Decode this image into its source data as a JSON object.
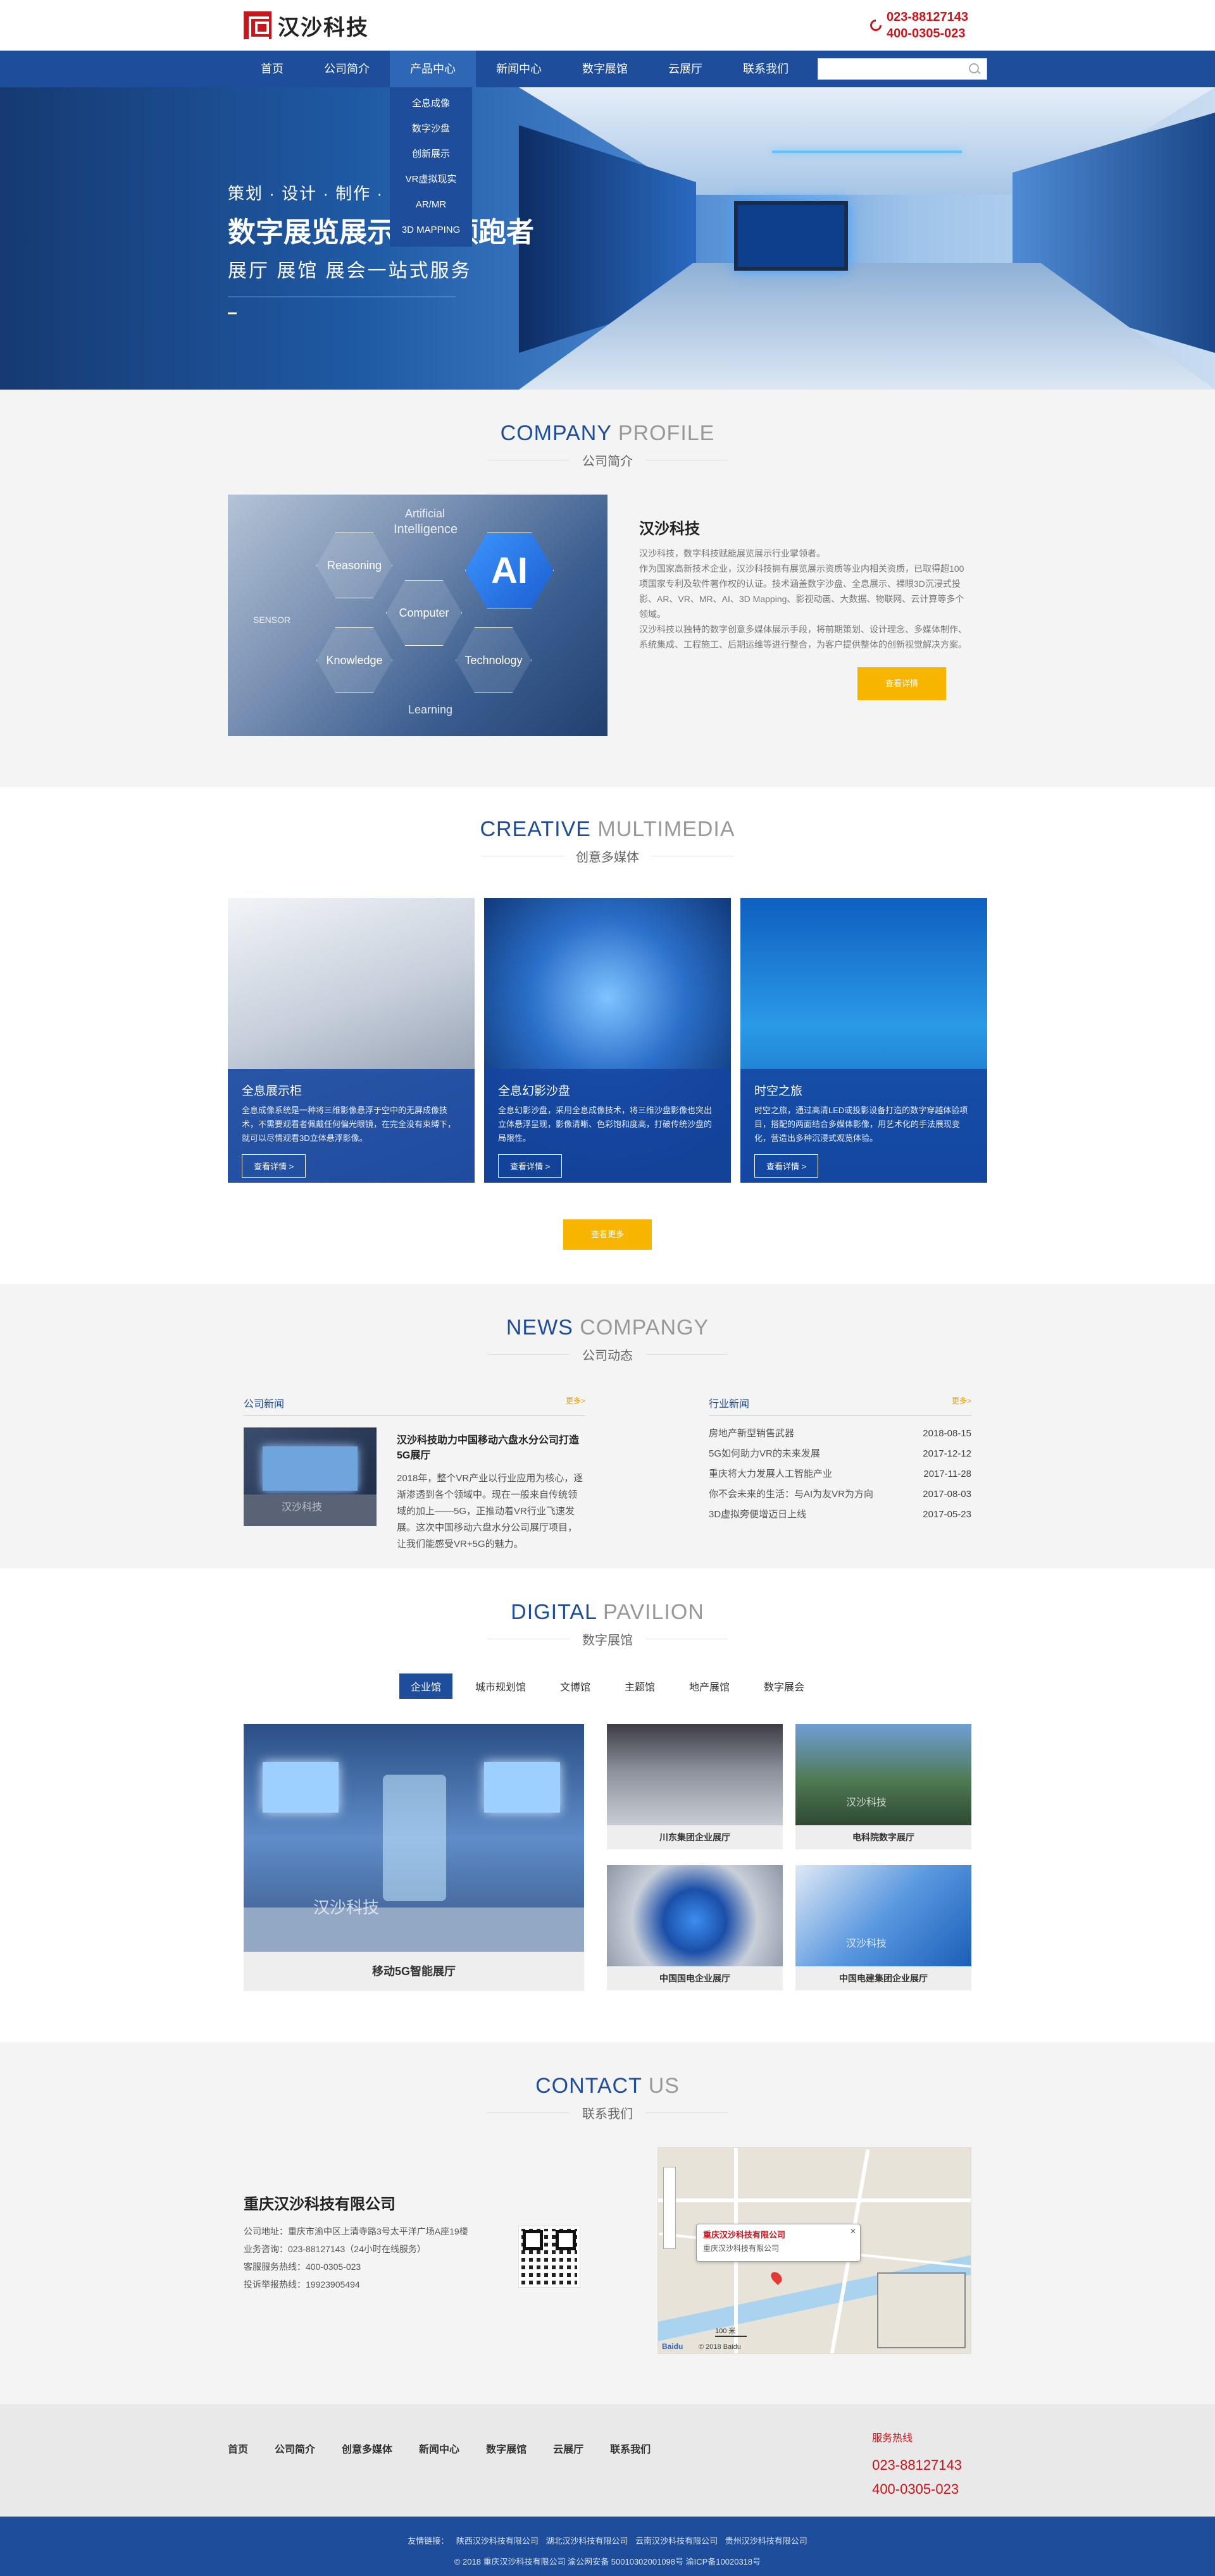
{
  "header": {
    "logo_text": "汉沙科技",
    "hotline": [
      "023-88127143",
      "400-0305-023"
    ]
  },
  "nav": {
    "items": [
      "首页",
      "公司简介",
      "产品中心",
      "新闻中心",
      "数字展馆",
      "云展厅",
      "联系我们"
    ],
    "active_index": 2,
    "dropdown": [
      "全息成像",
      "数字沙盘",
      "创新展示",
      "VR虚拟现实",
      "AR/MR",
      "3D MAPPING"
    ],
    "search_placeholder": ""
  },
  "banner": {
    "line1": "策划 · 设计 · 制作 · 集成 ·",
    "line2": "数字展览展示行业领跑者",
    "line3": "展厅 展馆 展会一站式服务"
  },
  "profile": {
    "title_en_main": "COMPANY",
    "title_en_rest": " PROFILE",
    "title_cn": "公司简介",
    "image_labels": {
      "artificial": "Artificial",
      "intelligence": "Intelligence",
      "reasoning": "Reasoning",
      "computer": "Computer",
      "knowledge": "Knowledge",
      "technology": "Technology",
      "learning": "Learning",
      "sensor": "SENSOR",
      "ai": "AI"
    },
    "heading": "汉沙科技",
    "paragraphs": [
      "汉沙科技，数字科技赋能展览展示行业掌领者。",
      "作为国家高新技术企业，汉沙科技拥有展览展示资质等业内相关资质，已取得超100项国家专利及软件著作权的认证。技术涵盖数字沙盘、全息展示、裸眼3D沉浸式投影、AR、VR、MR、AI、3D Mapping、影视动画、大数据、物联网、云计算等多个领域。",
      "汉沙科技以独特的数字创意多媒体展示手段，将前期策划、设计理念、多媒体制作、系统集成、工程施工、后期运维等进行整合，为客户提供整体的创新视觉解决方案。"
    ],
    "button": "查看详情"
  },
  "multimedia": {
    "title_en_main": "CREATIVE",
    "title_en_rest": " MULTIMEDIA",
    "title_cn": "创意多媒体",
    "cards": [
      {
        "title": "全息展示柜",
        "desc": "全息成像系统是一种将三维影像悬浮于空中的无屏成像技术，不需要观看者佩戴任何偏光眼镜，在完全没有束缚下，就可以尽情观看3D立体悬浮影像。",
        "button": "查看详情 >"
      },
      {
        "title": "全息幻影沙盘",
        "desc": "全息幻影沙盘，采用全息成像技术，将三维沙盘影像也突出立体悬浮呈现，影像清晰、色彩饱和度高，打破传统沙盘的局限性。",
        "button": "查看详情 >"
      },
      {
        "title": "时空之旅",
        "desc": "时空之旅，通过高清LED或投影设备打造的数字穿越体验项目，搭配的两面结合多媒体影像，用艺术化的手法展现变化，营造出多种沉浸式观览体验。",
        "button": "查看详情 >"
      }
    ],
    "more_button": "查看更多"
  },
  "news": {
    "title_en_main": "NEWS",
    "title_en_rest": " COMPANGY",
    "title_cn": "公司动态",
    "company": {
      "label": "公司新闻",
      "more": "更多>",
      "feature_title": "汉沙科技助力中国移动六盘水分公司打造5G展厅",
      "feature_text": "2018年，整个VR产业以行业应用为核心，逐渐渗透到各个领域中。现在一般来自传统领域的加上——5G，正推动着VR行业飞速发展。这次中国移动六盘水分公司展厅项目，让我们能感受VR+5G的魅力。",
      "thumb_watermark": "汉沙科技"
    },
    "industry": {
      "label": "行业新闻",
      "more": "更多>",
      "items": [
        {
          "title": "房地产新型销售武器",
          "date": "2018-08-15"
        },
        {
          "title": "5G如何助力VR的未来发展",
          "date": "2017-12-12"
        },
        {
          "title": "重庆将大力发展人工智能产业",
          "date": "2017-11-28"
        },
        {
          "title": "你不会未来的生活：与AI为友VR为方向",
          "date": "2017-08-03"
        },
        {
          "title": "3D虚拟旁便增迈日上线",
          "date": "2017-05-23"
        }
      ]
    }
  },
  "pavilion": {
    "title_en_main": "DIGITAL",
    "title_en_rest": " PAVILION",
    "title_cn": "数字展馆",
    "tabs": [
      "企业馆",
      "城市规划馆",
      "文博馆",
      "主题馆",
      "地产展馆",
      "数字展会"
    ],
    "active_tab": 0,
    "big": {
      "caption": "移动5G智能展厅",
      "watermark": "汉沙科技"
    },
    "smalls": [
      {
        "caption": "川东集团企业展厅",
        "watermark": ""
      },
      {
        "caption": "电科院数字展厅",
        "watermark": "汉沙科技"
      },
      {
        "caption": "中国国电企业展厅",
        "watermark": ""
      },
      {
        "caption": "中国电建集团企业展厅",
        "watermark": "汉沙科技"
      }
    ]
  },
  "contact": {
    "title_en_main": "CONTACT",
    "title_en_rest": " US",
    "title_cn": "联系我们",
    "company": "重庆汉沙科技有限公司",
    "lines": [
      "公司地址：重庆市渝中区上清寺路3号太平洋广场A座19楼",
      "业务咨询：023-88127143（24小时在线服务）",
      "客服服务热线：400-0305-023",
      "投诉举报热线：19923905494"
    ],
    "map": {
      "popup_title": "重庆汉沙科技有限公司",
      "popup_sub": "重庆汉沙科技有限公司",
      "scale": "100 米",
      "logo": "Baidu",
      "copyright": "© 2018 Baidu"
    }
  },
  "footer": {
    "links": [
      "首页",
      "公司简介",
      "创意多媒体",
      "新闻中心",
      "数字展馆",
      "云展厅",
      "联系我们"
    ],
    "hotline_label": "服务热线",
    "hotline": [
      "023-88127143",
      "400-0305-023"
    ]
  },
  "bottom": {
    "friend_label": "友情链接：",
    "friend_links": [
      "陕西汉沙科技有限公司",
      "湖北汉沙科技有限公司",
      "云南汉沙科技有限公司",
      "贵州汉沙科技有限公司"
    ],
    "copyright": "© 2018 重庆汉沙科技有限公司 渝公网安备 50010302001098号 渝ICP备10020318号"
  },
  "colors": {
    "brand_blue": "#1e4d9c",
    "brand_red": "#c8161d",
    "accent_yellow": "#f8b500"
  }
}
